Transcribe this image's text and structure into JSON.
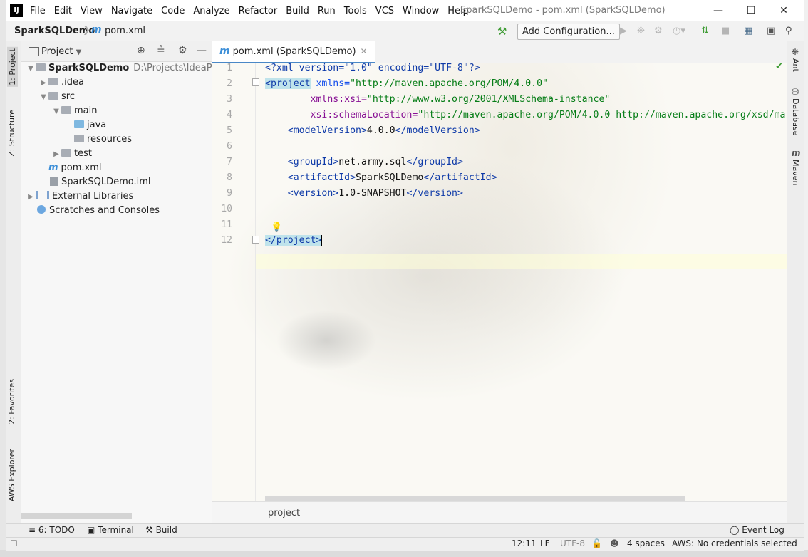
{
  "app": {
    "logo": "IJ",
    "window_title": "SparkSQLDemo - pom.xml (SparkSQLDemo)",
    "menu": [
      "File",
      "Edit",
      "View",
      "Navigate",
      "Code",
      "Analyze",
      "Refactor",
      "Build",
      "Run",
      "Tools",
      "VCS",
      "Window",
      "Help"
    ]
  },
  "navbar": {
    "project": "SparkSQLDemo",
    "file": "pom.xml",
    "add_configuration": "Add Configuration..."
  },
  "project_panel": {
    "title": "Project",
    "tree": [
      {
        "label": "SparkSQLDemo",
        "path": "D:\\Projects\\IdeaProjec",
        "bold": true
      },
      {
        "label": ".idea"
      },
      {
        "label": "src"
      },
      {
        "label": "main"
      },
      {
        "label": "java"
      },
      {
        "label": "resources"
      },
      {
        "label": "test"
      },
      {
        "label": "pom.xml"
      },
      {
        "label": "SparkSQLDemo.iml"
      },
      {
        "label": "External Libraries"
      },
      {
        "label": "Scratches and Consoles"
      }
    ]
  },
  "left_tabs": [
    "1: Project",
    "Z: Structure",
    "2: Favorites",
    "AWS Explorer"
  ],
  "right_tabs": [
    "Ant",
    "Database",
    "Maven"
  ],
  "editor": {
    "tab_label": "pom.xml (SparkSQLDemo)",
    "line_numbers": [
      "1",
      "2",
      "3",
      "4",
      "5",
      "6",
      "7",
      "8",
      "9",
      "10",
      "11",
      "12"
    ],
    "lines": [
      [
        "<?xml version=\"1.0\" encoding=\"UTF-8\"?>"
      ],
      [
        "<project",
        " xmlns=",
        "\"http://maven.apache.org/POM/4.0.0\""
      ],
      [
        "        xmlns:xsi=",
        "\"http://www.w3.org/2001/XMLSchema-instance\""
      ],
      [
        "        xsi:schemaLocation=",
        "\"http://maven.apache.org/POM/4.0.0 http://maven.apache.org/xsd/ma"
      ],
      [
        "    <modelVersion>",
        "4.0.0",
        "</modelVersion>"
      ],
      [
        ""
      ],
      [
        "    <groupId>",
        "net.army.sql",
        "</groupId>"
      ],
      [
        "    <artifactId>",
        "SparkSQLDemo",
        "</artifactId>"
      ],
      [
        "    <version>",
        "1.0-SNAPSHOT",
        "</version>"
      ],
      [
        ""
      ],
      [
        ""
      ],
      [
        "</project>"
      ]
    ],
    "breadcrumb": "project"
  },
  "bottom_tools": [
    "6: TODO",
    "Terminal",
    "Build",
    "Event Log"
  ],
  "status": {
    "position": "12:11",
    "line_sep": "LF",
    "encoding": "UTF-8",
    "indent": "4 spaces",
    "aws": "AWS: No credentials selected"
  }
}
